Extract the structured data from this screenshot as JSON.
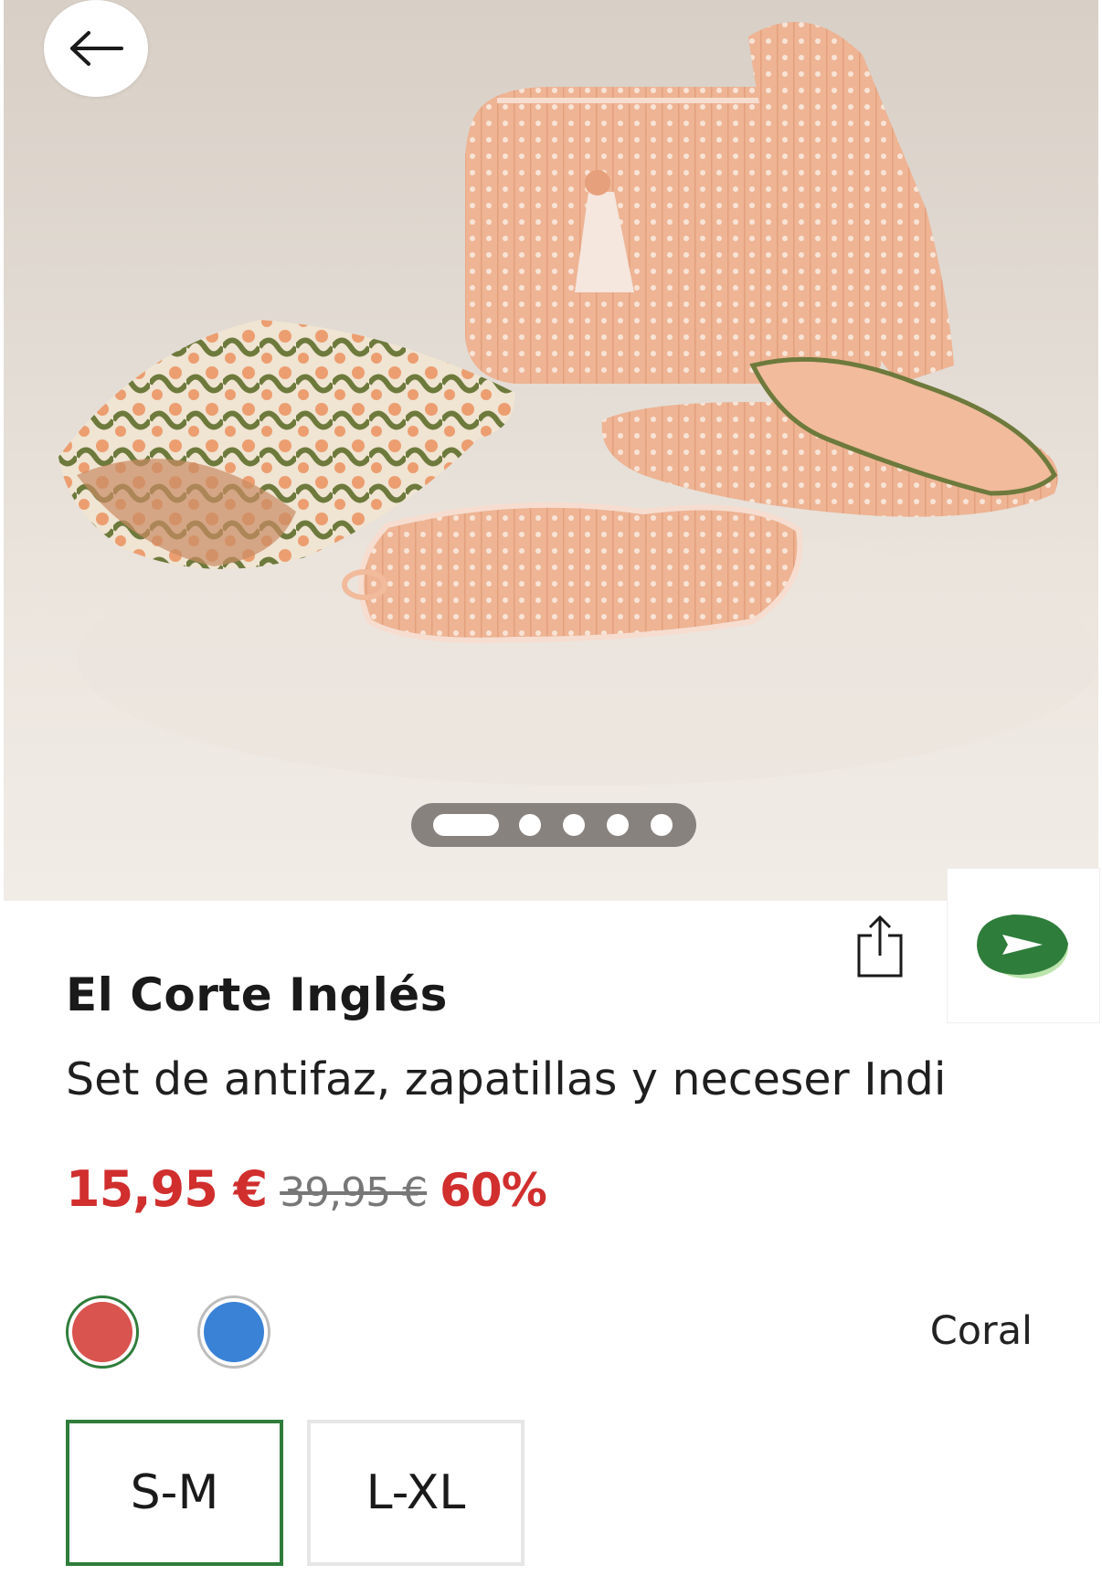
{
  "product": {
    "brand": "El Corte Inglés",
    "title": "Set de antifaz, zapatillas y neceser Indi",
    "price_current": "15,95 €",
    "price_original": "39,95 €",
    "discount": "60%"
  },
  "gallery": {
    "image_count": 5,
    "active_index": 0
  },
  "colors": {
    "options": [
      {
        "name": "coral",
        "hex": "#d9534f",
        "selected": true
      },
      {
        "name": "blue",
        "hex": "#3a82d6",
        "selected": false
      }
    ],
    "selected_label": "Coral"
  },
  "sizes": {
    "options": [
      "S-M",
      "L-XL"
    ],
    "selected": "S-M"
  },
  "icons": {
    "back": "arrow-left-icon",
    "share": "share-icon",
    "send": "send-icon"
  },
  "theme": {
    "price_red": "#d12e2e",
    "accent_green": "#2f7d3b"
  }
}
